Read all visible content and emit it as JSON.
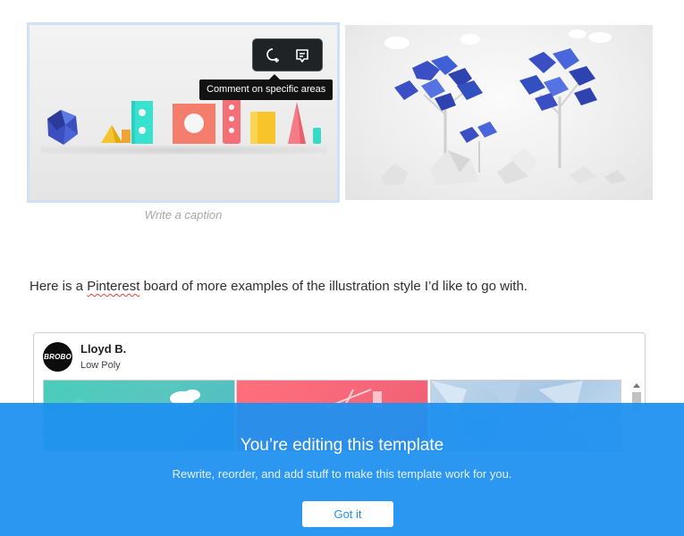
{
  "images": {
    "left": {
      "icon": "geometric-shapes-illustration"
    },
    "right": {
      "icon": "low-poly-trees-illustration"
    }
  },
  "caption": {
    "placeholder": "Write a caption"
  },
  "image_toolbar": {
    "buttons": [
      {
        "icon": "comment-area-icon"
      },
      {
        "icon": "comment-icon"
      }
    ],
    "tooltip": "Comment on specific areas"
  },
  "paragraph": {
    "before": "Here is a ",
    "link": "Pinterest",
    "after": " board of more examples of the illustration style I’d like to go with."
  },
  "embed": {
    "avatar_text": "BROBO",
    "name": "Lloyd B.",
    "board": "Low Poly"
  },
  "banner": {
    "title": "You’re editing this template",
    "subtitle": "Rewrite, reorder, and add stuff to make this template work for you.",
    "button": "Got it",
    "color": "#1e90f0"
  }
}
